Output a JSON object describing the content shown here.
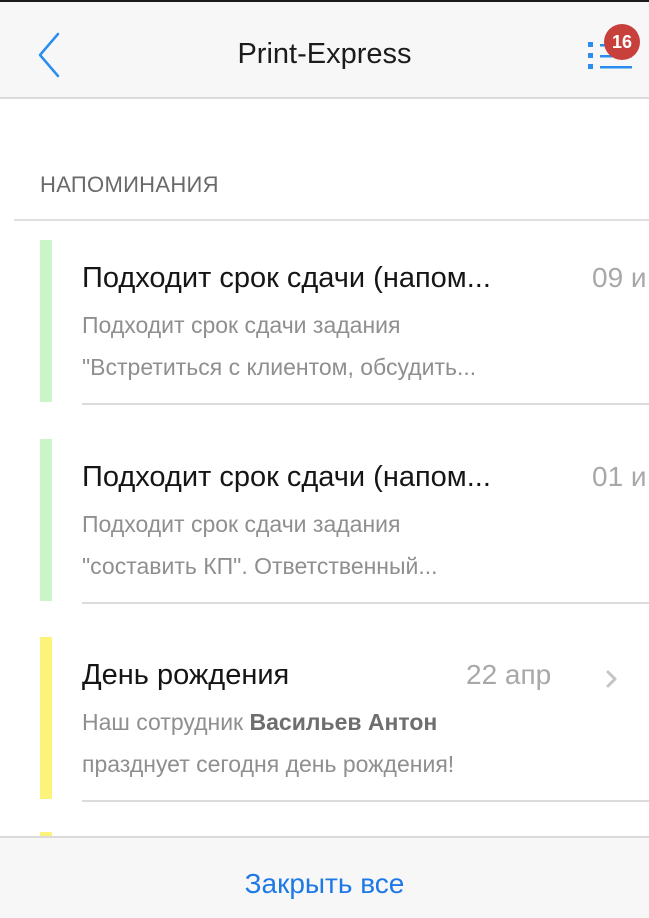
{
  "header": {
    "title": "Print-Express",
    "badge_count": "16",
    "accent_color": "#2a8ef0",
    "badge_color": "#c8403c"
  },
  "section": {
    "title": "НАПОМИНАНИЯ"
  },
  "items": [
    {
      "title": "Подходит срок сдачи (напом...",
      "date": "09 и",
      "line1": "Подходит срок сдачи задания",
      "line2": "\"Встретиться с клиентом, обсудить...",
      "bar_color": "#c9f5c9"
    },
    {
      "title": "Подходит срок сдачи (напом...",
      "date": "01 и",
      "line1": "Подходит срок сдачи задания",
      "line2": "\"составить КП\". Ответственный...",
      "bar_color": "#c9f5c9"
    },
    {
      "title": "День рождения",
      "date": "22 апр",
      "line1_prefix": "Наш сотрудник ",
      "line1_name": "Васильев Антон",
      "line2": "празднует сегодня день рождения!",
      "bar_color": "#fbf37a"
    }
  ],
  "footer": {
    "close_all_label": "Закрыть все"
  },
  "icons": [
    "back-arrow-icon",
    "menu-list-icon",
    "chevron-right-icon"
  ]
}
